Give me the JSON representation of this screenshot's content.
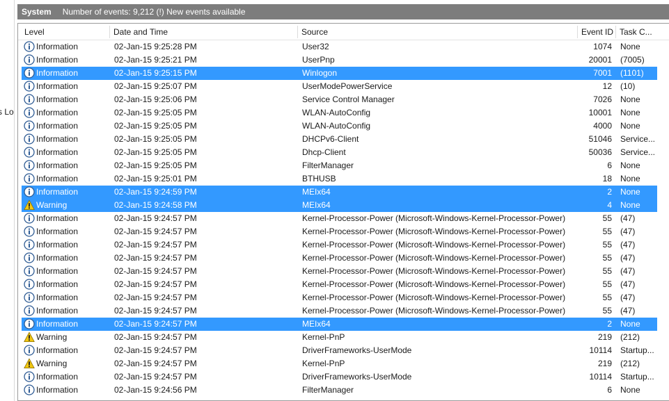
{
  "side_panel": {
    "cut_text": "s Lo"
  },
  "titlebar": {
    "title": "System",
    "info": "Number of events: 9,212 (!) New events available"
  },
  "columns": [
    "Level",
    "Date and Time",
    "Source",
    "Event ID",
    "Task C..."
  ],
  "rows": [
    {
      "level": "Information",
      "date": "02-Jan-15 9:25:28 PM",
      "source": "User32",
      "event_id": "1074",
      "task": "None",
      "selected": false
    },
    {
      "level": "Information",
      "date": "02-Jan-15 9:25:21 PM",
      "source": "UserPnp",
      "event_id": "20001",
      "task": "(7005)",
      "selected": false
    },
    {
      "level": "Information",
      "date": "02-Jan-15 9:25:15 PM",
      "source": "Winlogon",
      "event_id": "7001",
      "task": "(1101)",
      "selected": true
    },
    {
      "level": "Information",
      "date": "02-Jan-15 9:25:07 PM",
      "source": "UserModePowerService",
      "event_id": "12",
      "task": "(10)",
      "selected": false
    },
    {
      "level": "Information",
      "date": "02-Jan-15 9:25:06 PM",
      "source": "Service Control Manager",
      "event_id": "7026",
      "task": "None",
      "selected": false
    },
    {
      "level": "Information",
      "date": "02-Jan-15 9:25:05 PM",
      "source": "WLAN-AutoConfig",
      "event_id": "10001",
      "task": "None",
      "selected": false
    },
    {
      "level": "Information",
      "date": "02-Jan-15 9:25:05 PM",
      "source": "WLAN-AutoConfig",
      "event_id": "4000",
      "task": "None",
      "selected": false
    },
    {
      "level": "Information",
      "date": "02-Jan-15 9:25:05 PM",
      "source": "DHCPv6-Client",
      "event_id": "51046",
      "task": "Service...",
      "selected": false
    },
    {
      "level": "Information",
      "date": "02-Jan-15 9:25:05 PM",
      "source": "Dhcp-Client",
      "event_id": "50036",
      "task": "Service...",
      "selected": false
    },
    {
      "level": "Information",
      "date": "02-Jan-15 9:25:05 PM",
      "source": "FilterManager",
      "event_id": "6",
      "task": "None",
      "selected": false
    },
    {
      "level": "Information",
      "date": "02-Jan-15 9:25:01 PM",
      "source": "BTHUSB",
      "event_id": "18",
      "task": "None",
      "selected": false
    },
    {
      "level": "Information",
      "date": "02-Jan-15 9:24:59 PM",
      "source": "MEIx64",
      "event_id": "2",
      "task": "None",
      "selected": true
    },
    {
      "level": "Warning",
      "date": "02-Jan-15 9:24:58 PM",
      "source": "MEIx64",
      "event_id": "4",
      "task": "None",
      "selected": true
    },
    {
      "level": "Information",
      "date": "02-Jan-15 9:24:57 PM",
      "source": "Kernel-Processor-Power (Microsoft-Windows-Kernel-Processor-Power)",
      "event_id": "55",
      "task": "(47)",
      "selected": false
    },
    {
      "level": "Information",
      "date": "02-Jan-15 9:24:57 PM",
      "source": "Kernel-Processor-Power (Microsoft-Windows-Kernel-Processor-Power)",
      "event_id": "55",
      "task": "(47)",
      "selected": false
    },
    {
      "level": "Information",
      "date": "02-Jan-15 9:24:57 PM",
      "source": "Kernel-Processor-Power (Microsoft-Windows-Kernel-Processor-Power)",
      "event_id": "55",
      "task": "(47)",
      "selected": false
    },
    {
      "level": "Information",
      "date": "02-Jan-15 9:24:57 PM",
      "source": "Kernel-Processor-Power (Microsoft-Windows-Kernel-Processor-Power)",
      "event_id": "55",
      "task": "(47)",
      "selected": false
    },
    {
      "level": "Information",
      "date": "02-Jan-15 9:24:57 PM",
      "source": "Kernel-Processor-Power (Microsoft-Windows-Kernel-Processor-Power)",
      "event_id": "55",
      "task": "(47)",
      "selected": false
    },
    {
      "level": "Information",
      "date": "02-Jan-15 9:24:57 PM",
      "source": "Kernel-Processor-Power (Microsoft-Windows-Kernel-Processor-Power)",
      "event_id": "55",
      "task": "(47)",
      "selected": false
    },
    {
      "level": "Information",
      "date": "02-Jan-15 9:24:57 PM",
      "source": "Kernel-Processor-Power (Microsoft-Windows-Kernel-Processor-Power)",
      "event_id": "55",
      "task": "(47)",
      "selected": false
    },
    {
      "level": "Information",
      "date": "02-Jan-15 9:24:57 PM",
      "source": "Kernel-Processor-Power (Microsoft-Windows-Kernel-Processor-Power)",
      "event_id": "55",
      "task": "(47)",
      "selected": false
    },
    {
      "level": "Information",
      "date": "02-Jan-15 9:24:57 PM",
      "source": "MEIx64",
      "event_id": "2",
      "task": "None",
      "selected": true
    },
    {
      "level": "Warning",
      "date": "02-Jan-15 9:24:57 PM",
      "source": "Kernel-PnP",
      "event_id": "219",
      "task": "(212)",
      "selected": false
    },
    {
      "level": "Information",
      "date": "02-Jan-15 9:24:57 PM",
      "source": "DriverFrameworks-UserMode",
      "event_id": "10114",
      "task": "Startup...",
      "selected": false
    },
    {
      "level": "Warning",
      "date": "02-Jan-15 9:24:57 PM",
      "source": "Kernel-PnP",
      "event_id": "219",
      "task": "(212)",
      "selected": false
    },
    {
      "level": "Information",
      "date": "02-Jan-15 9:24:57 PM",
      "source": "DriverFrameworks-UserMode",
      "event_id": "10114",
      "task": "Startup...",
      "selected": false
    },
    {
      "level": "Information",
      "date": "02-Jan-15 9:24:56 PM",
      "source": "FilterManager",
      "event_id": "6",
      "task": "None",
      "selected": false
    }
  ],
  "colors": {
    "selection": "#3399ff",
    "titlebar": "#7d7d7d",
    "info_icon": "#2e5b94",
    "warning_icon": "#f2c811"
  }
}
